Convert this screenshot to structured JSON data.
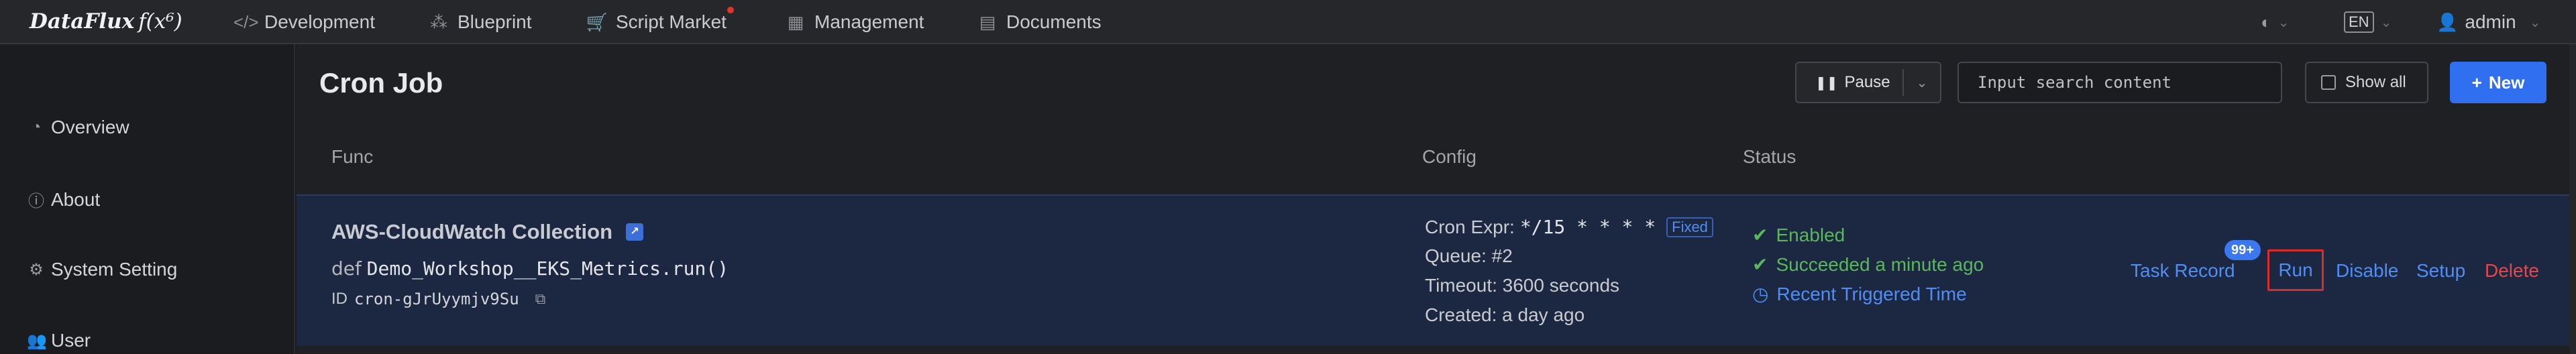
{
  "app": {
    "brand": "DataFlux",
    "brand_fx": "f(x⁶)"
  },
  "nav": [
    {
      "label": "Development",
      "icon": "code-icon"
    },
    {
      "label": "Blueprint",
      "icon": "blueprint-icon"
    },
    {
      "label": "Script Market",
      "icon": "cart-icon"
    },
    {
      "label": "Management",
      "icon": "grid-icon"
    },
    {
      "label": "Documents",
      "icon": "book-icon"
    }
  ],
  "header_right": {
    "lang": "EN",
    "user": "admin"
  },
  "sidebar": {
    "items": [
      {
        "label": "Overview",
        "icon": "dashboard-icon"
      },
      {
        "label": "About",
        "icon": "info-icon"
      },
      {
        "label": "System Setting",
        "icon": "gear-icon"
      },
      {
        "label": "User",
        "icon": "users-icon"
      }
    ]
  },
  "page": {
    "title": "Cron Job",
    "pause_label": "Pause",
    "search_placeholder": "Input search content",
    "show_all_label": "Show all",
    "new_label": "New"
  },
  "table": {
    "headers": {
      "func": "Func",
      "config": "Config",
      "status": "Status"
    },
    "row": {
      "title": "AWS-CloudWatch Collection",
      "func_kw": "def",
      "func_name": "Demo_Workshop__EKS_Metrics.run()",
      "id_label": "ID",
      "id_value": "cron-gJrUyymjv9Su",
      "cron_label": "Cron Expr:",
      "cron_value": "*/15 * * * *",
      "fixed_label": "Fixed",
      "queue": "Queue: #2",
      "timeout": "Timeout: 3600 seconds",
      "created": "Created: a day ago",
      "status_enabled": "Enabled",
      "status_succeeded": "Succeeded a minute ago",
      "status_recent": "Recent Triggered Time",
      "actions": {
        "task_record": "Task Record",
        "task_record_badge": "99+",
        "run": "Run",
        "disable": "Disable",
        "setup": "Setup",
        "delete": "Delete"
      }
    }
  },
  "colors": {
    "accent": "#2f6ff0",
    "link": "#4f8ef7",
    "success": "#59b85a",
    "danger": "#e8474a",
    "row_bg": "#1c2841"
  }
}
